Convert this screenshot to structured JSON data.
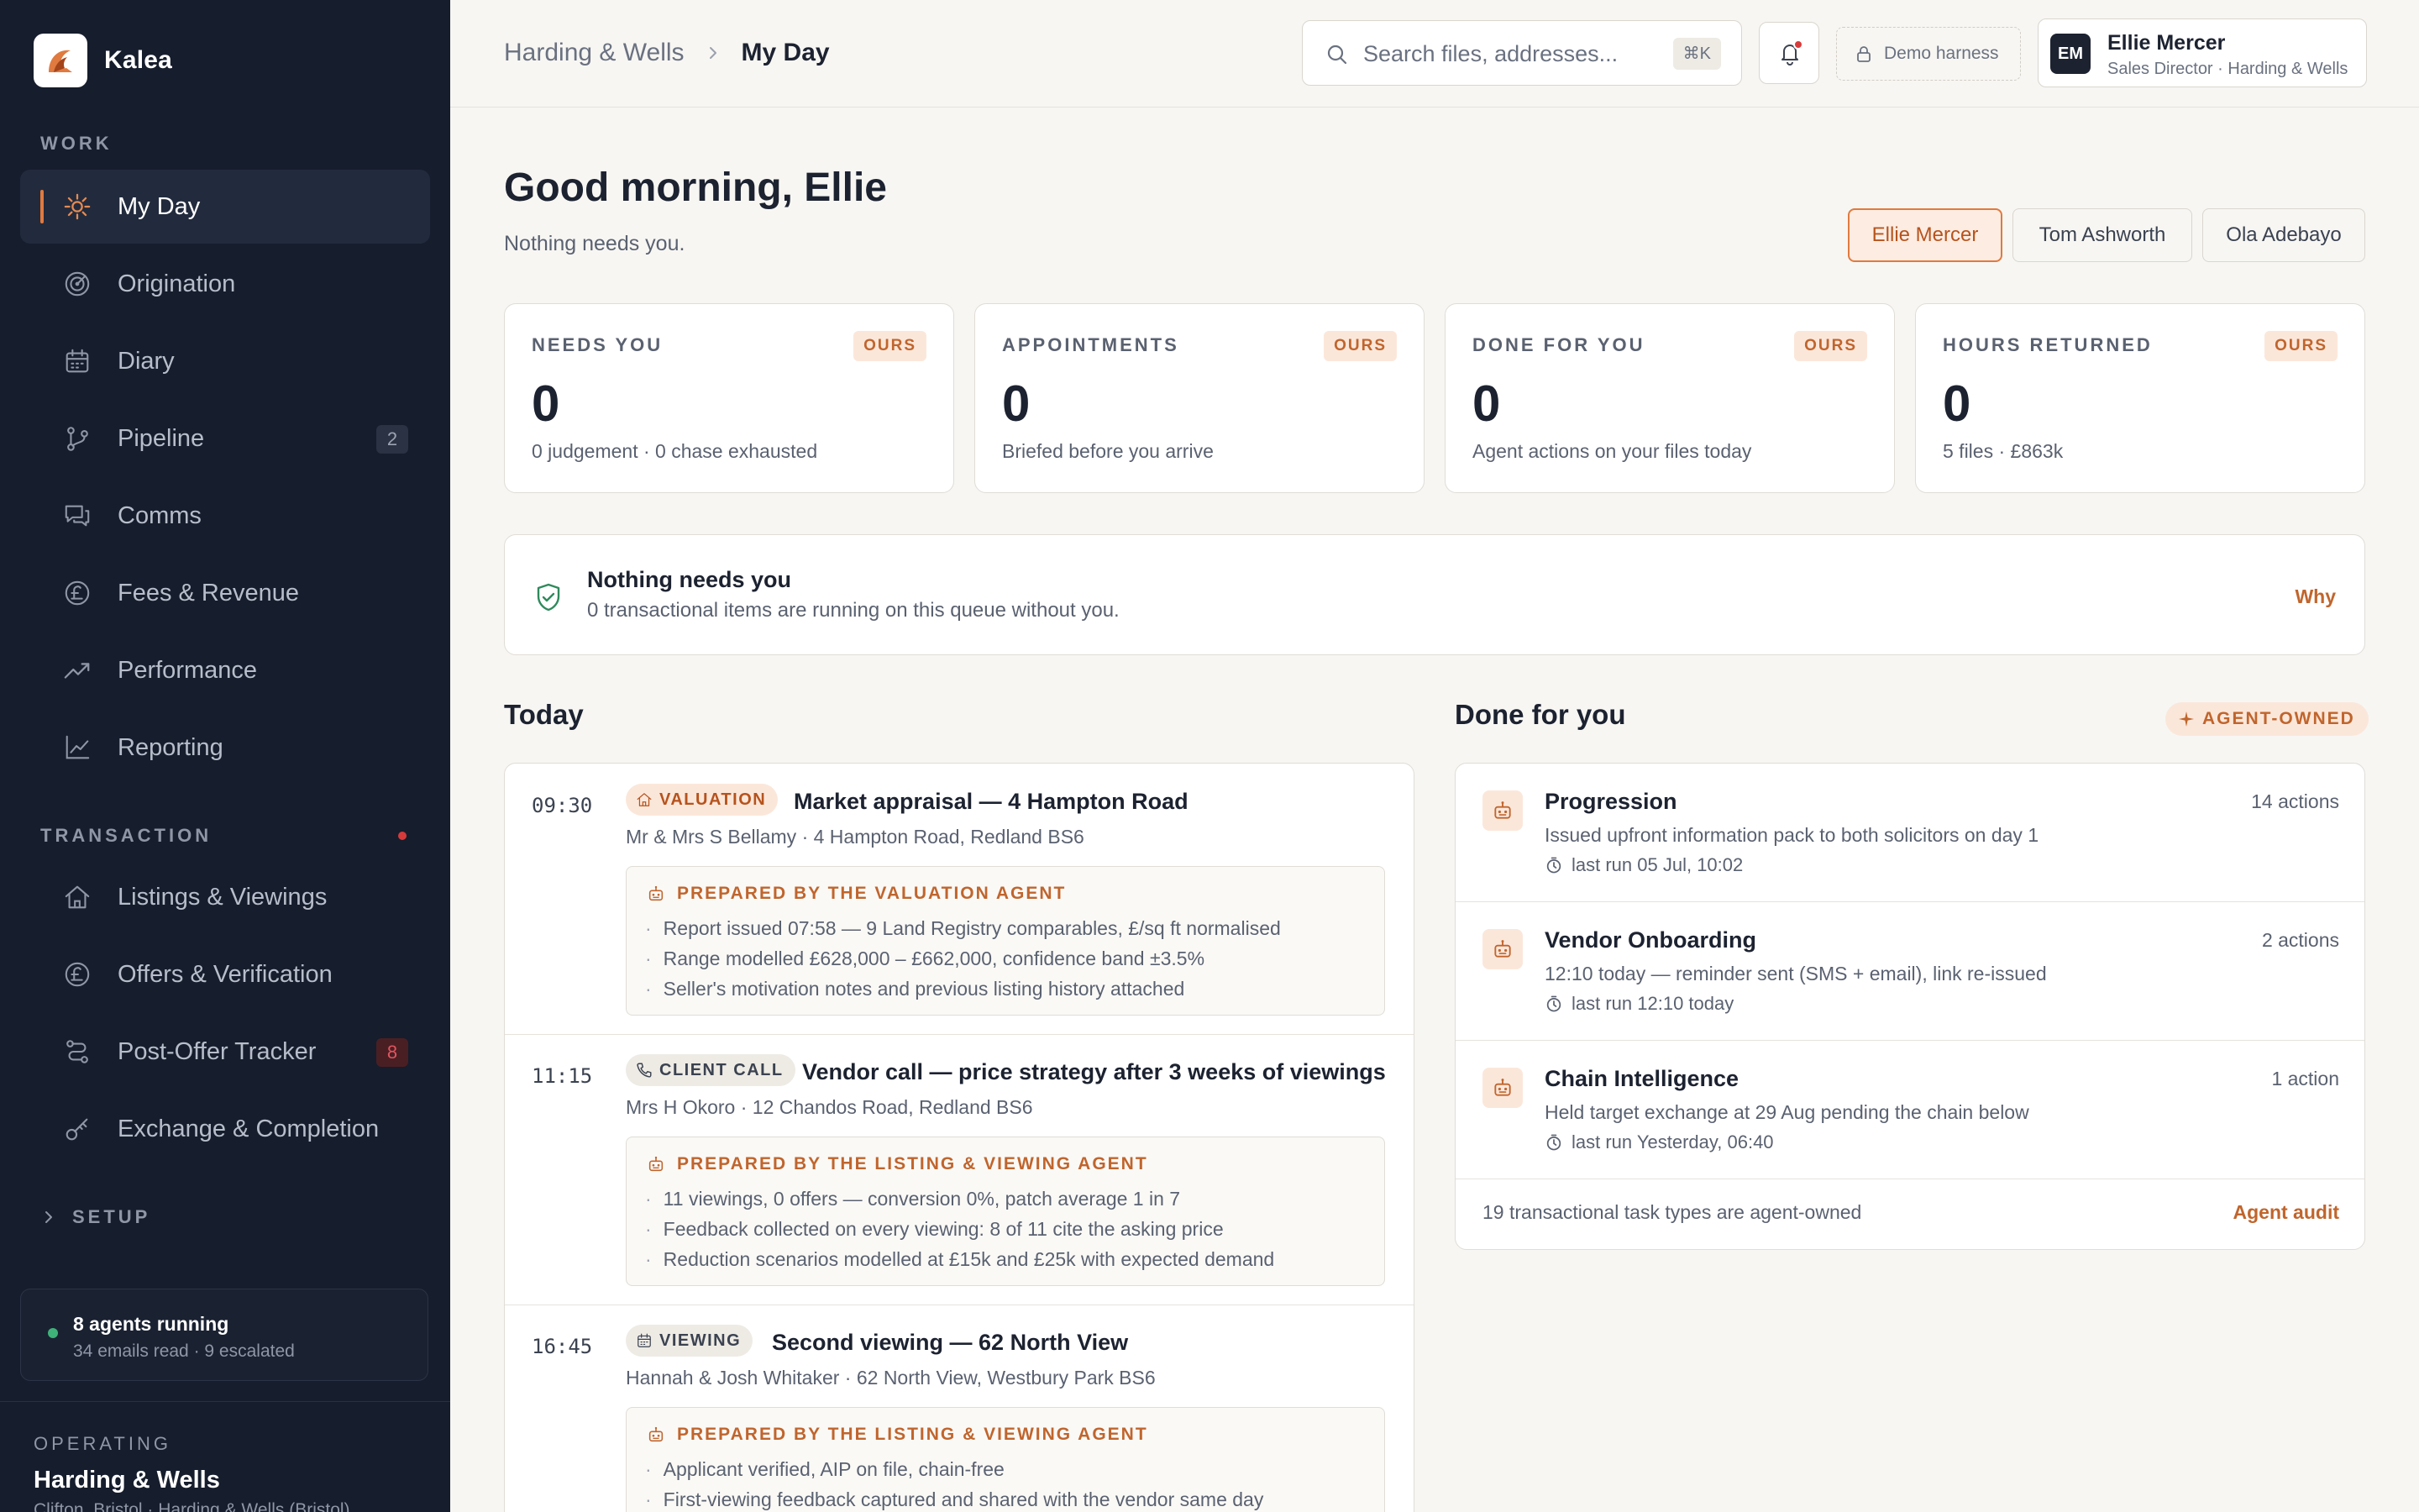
{
  "brand": {
    "name": "Kalea"
  },
  "sidebar": {
    "work_label": "WORK",
    "work_items": [
      {
        "label": "My Day",
        "icon": "sun-icon",
        "active": true
      },
      {
        "label": "Origination",
        "icon": "radar-icon"
      },
      {
        "label": "Diary",
        "icon": "calendar-icon"
      },
      {
        "label": "Pipeline",
        "icon": "branch-icon",
        "badge": "2"
      },
      {
        "label": "Comms",
        "icon": "chat-icon"
      },
      {
        "label": "Fees & Revenue",
        "icon": "pound-icon"
      },
      {
        "label": "Performance",
        "icon": "trend-up-icon"
      },
      {
        "label": "Reporting",
        "icon": "line-chart-icon"
      }
    ],
    "transaction_label": "TRANSACTION",
    "transaction_items": [
      {
        "label": "Listings & Viewings",
        "icon": "home-icon"
      },
      {
        "label": "Offers & Verification",
        "icon": "pound-icon"
      },
      {
        "label": "Post-Offer Tracker",
        "icon": "route-icon",
        "badge": "8"
      },
      {
        "label": "Exchange & Completion",
        "icon": "key-icon"
      }
    ],
    "setup_label": "SETUP",
    "agents": {
      "title": "8 agents running",
      "sub": "34 emails read · 9 escalated"
    },
    "operating": {
      "label": "OPERATING",
      "name": "Harding & Wells",
      "sub": "Clifton, Bristol · Harding & Wells (Bristol)"
    }
  },
  "header": {
    "breadcrumb": [
      "Harding & Wells",
      "My Day"
    ],
    "search_placeholder": "Search files, addresses...",
    "search_shortcut": "⌘K",
    "harness_label": "Demo harness",
    "user": {
      "initials": "EM",
      "name": "Ellie Mercer",
      "role": "Sales Director · Harding & Wells"
    }
  },
  "main": {
    "greeting": "Good morning, Ellie",
    "greeting_sub": "Nothing needs you.",
    "people": [
      "Ellie Mercer",
      "Tom Ashworth",
      "Ola Adebayo"
    ],
    "active_person": "Ellie Mercer",
    "stats": [
      {
        "label": "NEEDS YOU",
        "tag": "OURS",
        "value": "0",
        "sub": "0 judgement · 0 chase exhausted"
      },
      {
        "label": "APPOINTMENTS",
        "tag": "OURS",
        "value": "0",
        "sub": "Briefed before you arrive"
      },
      {
        "label": "DONE FOR YOU",
        "tag": "OURS",
        "value": "0",
        "sub": "Agent actions on your files today"
      },
      {
        "label": "HOURS RETURNED",
        "tag": "OURS",
        "value": "0",
        "sub": "5 files · £863k"
      }
    ],
    "banner": {
      "title": "Nothing needs you",
      "sub": "0 transactional items are running on this queue without you.",
      "link": "Why"
    },
    "today": {
      "title": "Today",
      "appointments": [
        {
          "time": "09:30",
          "tag": "VALUATION",
          "tag_style": "orange",
          "tag_icon": "home-icon",
          "title": "Market appraisal — 4 Hampton Road",
          "sub": "Mr & Mrs S Bellamy · 4 Hampton Road, Redland BS6",
          "prepared_by": "PREPARED BY THE VALUATION AGENT",
          "notes": [
            "Report issued 07:58 — 9 Land Registry comparables, £/sq ft normalised",
            "Range modelled £628,000 – £662,000, confidence band ±3.5%",
            "Seller's motivation notes and previous listing history attached"
          ]
        },
        {
          "time": "11:15",
          "tag": "CLIENT CALL",
          "tag_style": "grey",
          "tag_icon": "phone-icon",
          "title": "Vendor call — price strategy after 3 weeks of viewings",
          "sub": "Mrs H Okoro · 12 Chandos Road, Redland BS6",
          "prepared_by": "PREPARED BY THE LISTING & VIEWING AGENT",
          "notes": [
            "11 viewings, 0 offers — conversion 0%, patch average 1 in 7",
            "Feedback collected on every viewing: 8 of 11 cite the asking price",
            "Reduction scenarios modelled at £15k and £25k with expected demand"
          ]
        },
        {
          "time": "16:45",
          "tag": "VIEWING",
          "tag_style": "grey",
          "tag_icon": "calendar-icon",
          "title": "Second viewing — 62 North View",
          "sub": "Hannah & Josh Whitaker · 62 North View, Westbury Park BS6",
          "prepared_by": "PREPARED BY THE LISTING & VIEWING AGENT",
          "notes": [
            "Applicant verified, AIP on file, chain-free",
            "First-viewing feedback captured and shared with the vendor same day"
          ]
        }
      ]
    },
    "done_for_you": {
      "title": "Done for you",
      "badge": "AGENT-OWNED",
      "items": [
        {
          "title": "Progression",
          "count": "14 actions",
          "sub": "Issued upfront information pack to both solicitors on day 1",
          "run": "last run 05 Jul, 10:02"
        },
        {
          "title": "Vendor Onboarding",
          "count": "2 actions",
          "sub": "12:10 today — reminder sent (SMS + email), link re-issued",
          "run": "last run 12:10 today"
        },
        {
          "title": "Chain Intelligence",
          "count": "1 action",
          "sub": "Held target exchange at 29 Aug pending the chain below",
          "run": "last run Yesterday, 06:40"
        }
      ],
      "footer_text": "19 transactional task types are agent-owned",
      "footer_link": "Agent audit"
    }
  },
  "colors": {
    "accent": "#e07a3f",
    "sidebar_bg": "#161d2c",
    "page_bg": "#f7f6f3",
    "success": "#2f8a5c",
    "alert": "#d63b3b"
  }
}
